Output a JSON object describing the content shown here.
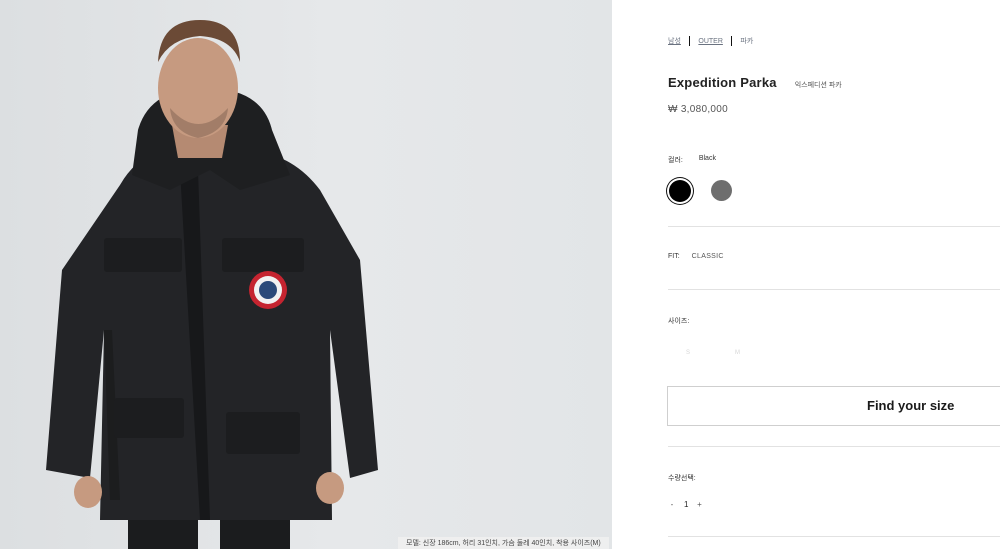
{
  "image": {
    "alt": "Model wearing black Expedition Parka",
    "model_info": "모델: 신장 186cm, 허리 31인치, 가슴 둘레 40인치, 착용 사이즈(M)"
  },
  "breadcrumb": [
    {
      "label": "남성"
    },
    {
      "label": "OUTER"
    },
    {
      "label": "파카"
    }
  ],
  "product": {
    "name": "Expedition Parka",
    "name_local": "익스페디션 파카",
    "price": "₩ 3,080,000"
  },
  "color": {
    "label": "컬러:",
    "selected": "Black",
    "swatches": [
      {
        "name": "Black",
        "hex": "#000000"
      },
      {
        "name": "Grey",
        "hex": "#6e6e6e"
      }
    ]
  },
  "fit": {
    "label": "FIT:",
    "value": "CLASSIC"
  },
  "size": {
    "label": "사이즈:",
    "options": [
      "S",
      "M"
    ],
    "find_size_label": "Find your size"
  },
  "quantity": {
    "label": "수량선택:",
    "minus": "-",
    "value": "1",
    "plus": "+"
  }
}
